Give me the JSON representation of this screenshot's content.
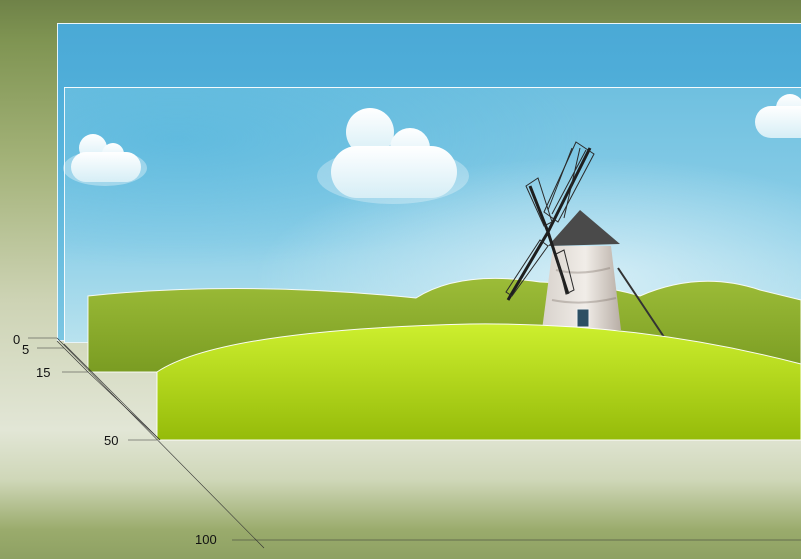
{
  "depth_scale": {
    "labels": [
      "0",
      "5",
      "15",
      "50",
      "100"
    ]
  },
  "colors": {
    "sky_top": "#4aa9d6",
    "sky_light": "#b8e2ee",
    "hill_back": "#8cab2c",
    "hill_front_top": "#c8ec2c",
    "hill_front_bottom": "#96bc0c",
    "background_olive": "#6f8248"
  },
  "scene": {
    "clouds": [
      "cloud-left",
      "cloud-center",
      "cloud-right"
    ],
    "landmark": "windmill-icon"
  }
}
